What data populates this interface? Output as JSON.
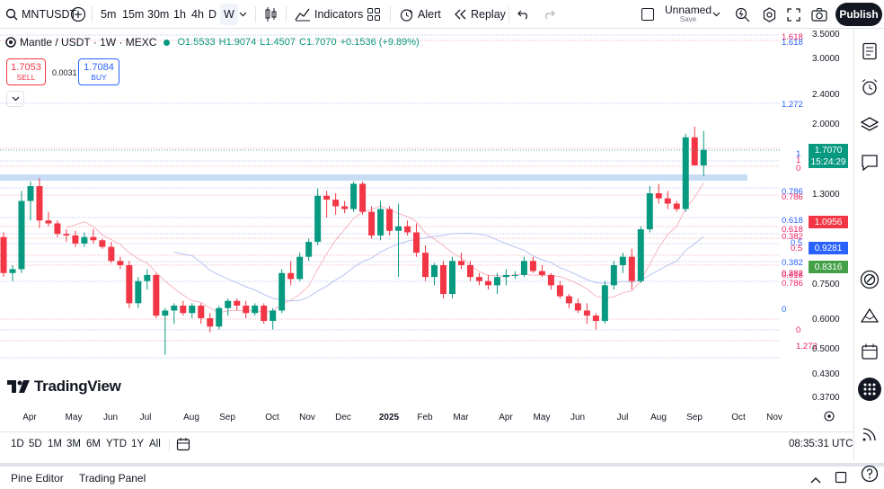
{
  "toolbar": {
    "symbol": "MNTUSDT",
    "intervals": [
      "5m",
      "15m",
      "30m",
      "1h",
      "4h",
      "D",
      "W"
    ],
    "active_interval": "W",
    "indicators_label": "Indicators",
    "alert_label": "Alert",
    "replay_label": "Replay",
    "layout_name": "Unnamed",
    "layout_status": "Save",
    "publish_label": "Publish"
  },
  "legend": {
    "title": "Mantle / USDT · 1W · MEXC",
    "open": "O1.5533",
    "high": "H1.9074",
    "low": "L1.4507",
    "close": "C1.7070",
    "change": "+0.1536 (+9.89%)",
    "sell_price": "1.7053",
    "sell_label": "SELL",
    "spread": "0.0031",
    "buy_price": "1.7084",
    "buy_label": "BUY"
  },
  "watermark": "TradingView",
  "price_axis": {
    "ticks": [
      "3.5000",
      "3.0000",
      "2.4000",
      "2.0000",
      "1.3000",
      "0.7500",
      "0.6000",
      "0.5000",
      "0.4300",
      "0.3700"
    ],
    "tags": [
      {
        "text": "1.7070",
        "color": "#089981"
      },
      {
        "text": "15:24:29",
        "color": "#089981"
      },
      {
        "text": "1.0956",
        "color": "#f23645"
      },
      {
        "text": "0.9281",
        "color": "#2962ff"
      },
      {
        "text": "0.8316",
        "color": "#43a047"
      }
    ]
  },
  "fib_labels": [
    {
      "text": "1.618",
      "color": "#e91e63"
    },
    {
      "text": "1.618",
      "color": "#2962ff"
    },
    {
      "text": "1.272",
      "color": "#2962ff"
    },
    {
      "text": "1",
      "color": "#2962ff"
    },
    {
      "text": "1",
      "color": "#e91e63"
    },
    {
      "text": "0",
      "color": "#e91e63"
    },
    {
      "text": "0.786",
      "color": "#2962ff"
    },
    {
      "text": "0.786",
      "color": "#e91e63"
    },
    {
      "text": "0.618",
      "color": "#2962ff"
    },
    {
      "text": "0.618",
      "color": "#e91e63"
    },
    {
      "text": "0.382",
      "color": "#e91e63"
    },
    {
      "text": "0.5",
      "color": "#2962ff"
    },
    {
      "text": "0.5",
      "color": "#e91e63"
    },
    {
      "text": "0.382",
      "color": "#2962ff"
    },
    {
      "text": "0.382",
      "color": "#e91e63"
    },
    {
      "text": "0.618",
      "color": "#e91e63"
    },
    {
      "text": "0.786",
      "color": "#e91e63"
    },
    {
      "text": "0",
      "color": "#2962ff"
    },
    {
      "text": "0",
      "color": "#e91e63"
    },
    {
      "text": "1.272",
      "color": "#e91e63"
    }
  ],
  "time_axis": [
    "Apr",
    "May",
    "Jun",
    "Jul",
    "Aug",
    "Sep",
    "Oct",
    "Nov",
    "Dec",
    "2025",
    "Feb",
    "Mar",
    "Apr",
    "May",
    "Jun",
    "Jul",
    "Aug",
    "Sep",
    "Oct",
    "Nov"
  ],
  "timeframes": [
    "1D",
    "5D",
    "1M",
    "3M",
    "6M",
    "YTD",
    "1Y",
    "All"
  ],
  "clock": "08:35:31 UTC",
  "bottom": {
    "pine_editor": "Pine Editor",
    "trading_panel": "Trading Panel"
  },
  "colors": {
    "up": "#089981",
    "down": "#f23645",
    "ma_pink": "#f7b6c2",
    "ma_blue": "#b7c3f2"
  },
  "chart_data": {
    "type": "candlestick",
    "title": "Mantle / USDT · 1W · MEXC",
    "candles": [
      {
        "o": 0.99,
        "h": 1.02,
        "l": 0.78,
        "c": 0.8
      },
      {
        "o": 0.8,
        "h": 0.84,
        "l": 0.76,
        "c": 0.82
      },
      {
        "o": 0.82,
        "h": 1.32,
        "l": 0.8,
        "c": 1.24
      },
      {
        "o": 1.24,
        "h": 1.4,
        "l": 1.1,
        "c": 1.36
      },
      {
        "o": 1.36,
        "h": 1.43,
        "l": 1.05,
        "c": 1.1
      },
      {
        "o": 1.1,
        "h": 1.16,
        "l": 1.06,
        "c": 1.08
      },
      {
        "o": 1.08,
        "h": 1.1,
        "l": 0.99,
        "c": 1.01
      },
      {
        "o": 1.01,
        "h": 1.04,
        "l": 0.96,
        "c": 1.0
      },
      {
        "o": 1.0,
        "h": 1.03,
        "l": 0.93,
        "c": 0.95
      },
      {
        "o": 0.95,
        "h": 1.02,
        "l": 0.93,
        "c": 0.99
      },
      {
        "o": 0.99,
        "h": 1.04,
        "l": 0.95,
        "c": 0.97
      },
      {
        "o": 0.97,
        "h": 0.98,
        "l": 0.92,
        "c": 0.93
      },
      {
        "o": 0.93,
        "h": 0.96,
        "l": 0.85,
        "c": 0.86
      },
      {
        "o": 0.86,
        "h": 0.88,
        "l": 0.82,
        "c": 0.84
      },
      {
        "o": 0.84,
        "h": 0.86,
        "l": 0.64,
        "c": 0.66
      },
      {
        "o": 0.66,
        "h": 0.78,
        "l": 0.64,
        "c": 0.76
      },
      {
        "o": 0.76,
        "h": 0.82,
        "l": 0.72,
        "c": 0.79
      },
      {
        "o": 0.79,
        "h": 0.8,
        "l": 0.6,
        "c": 0.61
      },
      {
        "o": 0.61,
        "h": 0.64,
        "l": 0.48,
        "c": 0.63
      },
      {
        "o": 0.63,
        "h": 0.66,
        "l": 0.58,
        "c": 0.65
      },
      {
        "o": 0.65,
        "h": 0.67,
        "l": 0.61,
        "c": 0.62
      },
      {
        "o": 0.62,
        "h": 0.66,
        "l": 0.6,
        "c": 0.65
      },
      {
        "o": 0.65,
        "h": 0.66,
        "l": 0.58,
        "c": 0.6
      },
      {
        "o": 0.6,
        "h": 0.62,
        "l": 0.55,
        "c": 0.57
      },
      {
        "o": 0.57,
        "h": 0.65,
        "l": 0.56,
        "c": 0.64
      },
      {
        "o": 0.64,
        "h": 0.68,
        "l": 0.61,
        "c": 0.67
      },
      {
        "o": 0.67,
        "h": 0.68,
        "l": 0.63,
        "c": 0.65
      },
      {
        "o": 0.65,
        "h": 0.67,
        "l": 0.6,
        "c": 0.62
      },
      {
        "o": 0.62,
        "h": 0.66,
        "l": 0.61,
        "c": 0.65
      },
      {
        "o": 0.65,
        "h": 0.66,
        "l": 0.58,
        "c": 0.59
      },
      {
        "o": 0.59,
        "h": 0.64,
        "l": 0.56,
        "c": 0.63
      },
      {
        "o": 0.63,
        "h": 0.82,
        "l": 0.62,
        "c": 0.8
      },
      {
        "o": 0.8,
        "h": 0.86,
        "l": 0.74,
        "c": 0.77
      },
      {
        "o": 0.77,
        "h": 0.9,
        "l": 0.76,
        "c": 0.88
      },
      {
        "o": 0.88,
        "h": 0.98,
        "l": 0.86,
        "c": 0.96
      },
      {
        "o": 0.96,
        "h": 1.34,
        "l": 0.94,
        "c": 1.28
      },
      {
        "o": 1.28,
        "h": 1.32,
        "l": 1.12,
        "c": 1.25
      },
      {
        "o": 1.25,
        "h": 1.3,
        "l": 1.14,
        "c": 1.2
      },
      {
        "o": 1.2,
        "h": 1.24,
        "l": 1.15,
        "c": 1.18
      },
      {
        "o": 1.18,
        "h": 1.4,
        "l": 1.16,
        "c": 1.38
      },
      {
        "o": 1.38,
        "h": 1.4,
        "l": 1.14,
        "c": 1.16
      },
      {
        "o": 1.16,
        "h": 1.2,
        "l": 0.98,
        "c": 1.0
      },
      {
        "o": 1.0,
        "h": 1.24,
        "l": 0.97,
        "c": 1.18
      },
      {
        "o": 1.18,
        "h": 1.2,
        "l": 1.0,
        "c": 1.03
      },
      {
        "o": 1.03,
        "h": 1.22,
        "l": 0.78,
        "c": 1.06
      },
      {
        "o": 1.06,
        "h": 1.1,
        "l": 1.0,
        "c": 1.02
      },
      {
        "o": 1.02,
        "h": 1.08,
        "l": 0.88,
        "c": 0.9
      },
      {
        "o": 0.9,
        "h": 0.94,
        "l": 0.76,
        "c": 0.78
      },
      {
        "o": 0.78,
        "h": 0.85,
        "l": 0.74,
        "c": 0.84
      },
      {
        "o": 0.84,
        "h": 0.86,
        "l": 0.68,
        "c": 0.7
      },
      {
        "o": 0.7,
        "h": 0.88,
        "l": 0.68,
        "c": 0.86
      },
      {
        "o": 0.86,
        "h": 0.9,
        "l": 0.82,
        "c": 0.84
      },
      {
        "o": 0.84,
        "h": 0.86,
        "l": 0.76,
        "c": 0.78
      },
      {
        "o": 0.78,
        "h": 0.8,
        "l": 0.74,
        "c": 0.76
      },
      {
        "o": 0.76,
        "h": 0.79,
        "l": 0.72,
        "c": 0.74
      },
      {
        "o": 0.74,
        "h": 0.8,
        "l": 0.7,
        "c": 0.78
      },
      {
        "o": 0.78,
        "h": 0.82,
        "l": 0.74,
        "c": 0.79
      },
      {
        "o": 0.79,
        "h": 0.81,
        "l": 0.77,
        "c": 0.79
      },
      {
        "o": 0.79,
        "h": 0.88,
        "l": 0.78,
        "c": 0.86
      },
      {
        "o": 0.86,
        "h": 0.88,
        "l": 0.8,
        "c": 0.81
      },
      {
        "o": 0.81,
        "h": 0.84,
        "l": 0.78,
        "c": 0.79
      },
      {
        "o": 0.79,
        "h": 0.8,
        "l": 0.72,
        "c": 0.74
      },
      {
        "o": 0.74,
        "h": 0.76,
        "l": 0.68,
        "c": 0.69
      },
      {
        "o": 0.69,
        "h": 0.7,
        "l": 0.64,
        "c": 0.66
      },
      {
        "o": 0.66,
        "h": 0.68,
        "l": 0.62,
        "c": 0.63
      },
      {
        "o": 0.63,
        "h": 0.66,
        "l": 0.58,
        "c": 0.61
      },
      {
        "o": 0.61,
        "h": 0.62,
        "l": 0.56,
        "c": 0.59
      },
      {
        "o": 0.59,
        "h": 0.76,
        "l": 0.58,
        "c": 0.74
      },
      {
        "o": 0.74,
        "h": 0.86,
        "l": 0.72,
        "c": 0.84
      },
      {
        "o": 0.84,
        "h": 0.9,
        "l": 0.8,
        "c": 0.88
      },
      {
        "o": 0.88,
        "h": 0.92,
        "l": 0.72,
        "c": 0.76
      },
      {
        "o": 0.76,
        "h": 1.06,
        "l": 0.75,
        "c": 1.04
      },
      {
        "o": 1.04,
        "h": 1.36,
        "l": 1.02,
        "c": 1.3
      },
      {
        "o": 1.3,
        "h": 1.38,
        "l": 1.22,
        "c": 1.26
      },
      {
        "o": 1.26,
        "h": 1.32,
        "l": 1.18,
        "c": 1.22
      },
      {
        "o": 1.22,
        "h": 1.24,
        "l": 1.16,
        "c": 1.18
      },
      {
        "o": 1.18,
        "h": 1.88,
        "l": 1.16,
        "c": 1.84
      },
      {
        "o": 1.84,
        "h": 1.96,
        "l": 1.56,
        "c": 1.55
      },
      {
        "o": 1.55,
        "h": 1.91,
        "l": 1.45,
        "c": 1.71
      }
    ],
    "current_price": 1.707,
    "moving_averages": [
      "pink",
      "blue"
    ]
  }
}
